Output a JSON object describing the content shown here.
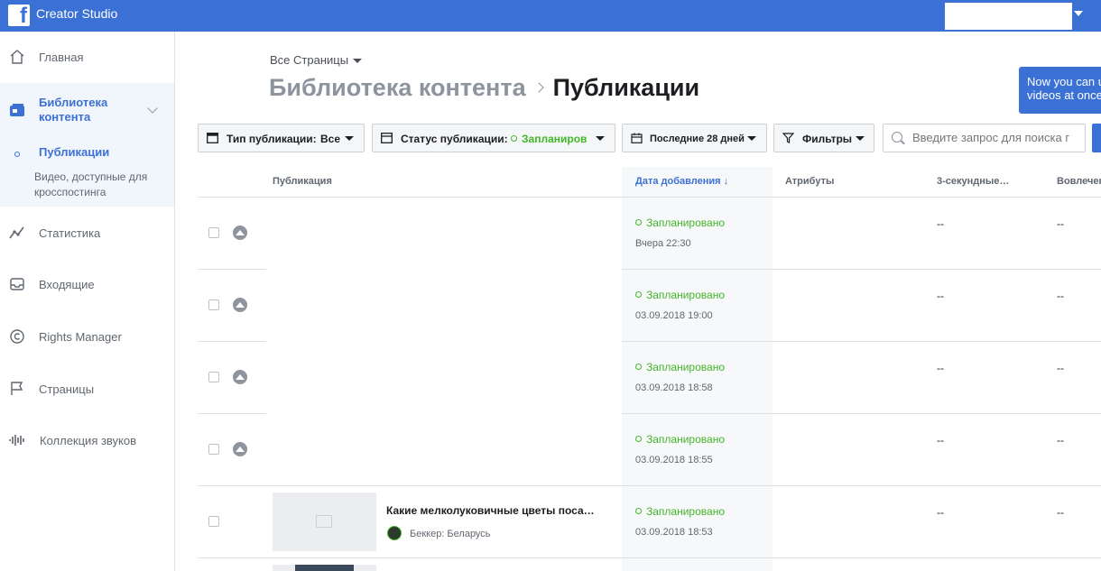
{
  "app": {
    "title": "Creator Studio",
    "logo_glyph": "f"
  },
  "sidebar": {
    "items": [
      {
        "label": "Главная",
        "icon": "home-icon"
      },
      {
        "label": "Библиотека контента",
        "icon": "content-library-icon"
      },
      {
        "label": "Статистика",
        "icon": "insights-icon"
      },
      {
        "label": "Входящие",
        "icon": "inbox-icon"
      },
      {
        "label": "Rights Manager",
        "icon": "copyright-icon"
      },
      {
        "label": "Страницы",
        "icon": "flag-icon"
      },
      {
        "label": "Коллекция звуков",
        "icon": "sound-wave-icon"
      }
    ],
    "sub_active": "Публикации",
    "sub_desc": "Видео, доступные для кросспостинга"
  },
  "header": {
    "page_selector": "Все Страницы",
    "breadcrumb_parent": "Библиотека контента",
    "breadcrumb_current": "Публикации"
  },
  "tooltip": {
    "line1": "Now you can u",
    "line2": "videos at once"
  },
  "filters": {
    "post_type_label": "Тип публикации:",
    "post_type_value": "Все",
    "post_status_label": "Статус публикации:",
    "post_status_value": "Запланиров",
    "date_range": "Последние 28 дней",
    "filters_label": "Фильтры",
    "search_placeholder": "Введите запрос для поиска г"
  },
  "table": {
    "headers": {
      "post": "Публикация",
      "date_added": "Дата добавления",
      "attributes": "Атрибуты",
      "three_sec": "3-секундные…",
      "engagement": "Вовлечен"
    },
    "rows": [
      {
        "status": "Запланировано",
        "date": "Вчера 22:30",
        "three_sec": "--",
        "engagement": "--"
      },
      {
        "status": "Запланировано",
        "date": "03.09.2018 19:00",
        "three_sec": "--",
        "engagement": "--"
      },
      {
        "status": "Запланировано",
        "date": "03.09.2018 18:58",
        "three_sec": "--",
        "engagement": "--"
      },
      {
        "status": "Запланировано",
        "date": "03.09.2018 18:55",
        "three_sec": "--",
        "engagement": "--"
      },
      {
        "status": "Запланировано",
        "date": "03.09.2018 18:53",
        "three_sec": "--",
        "engagement": "--",
        "title": "Какие мелколуковичные цветы поса…",
        "author": "Беккер: Беларусь"
      }
    ]
  },
  "colors": {
    "brand": "#3b70d4",
    "status_green": "#42b72a"
  }
}
